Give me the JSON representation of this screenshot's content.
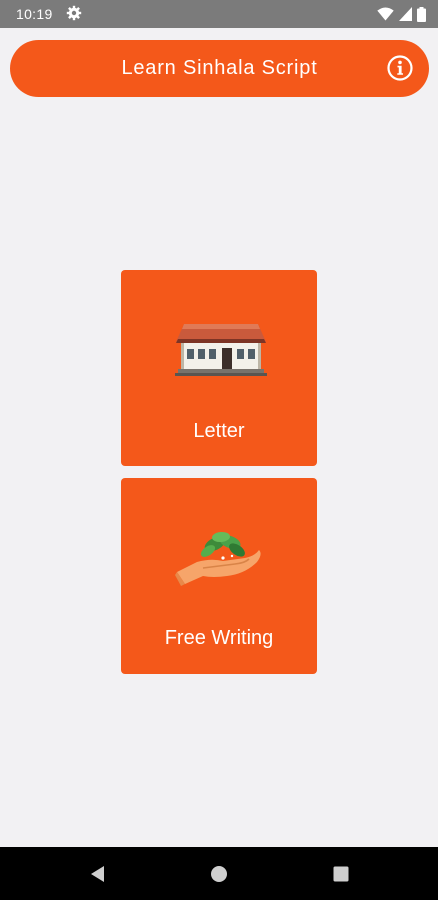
{
  "status_bar": {
    "time": "10:19",
    "icons": [
      "gear-icon",
      "wifi-icon",
      "signal-icon",
      "battery-icon"
    ]
  },
  "header": {
    "title": "Learn Sinhala Script",
    "info_icon": "info-icon"
  },
  "menu": {
    "items": [
      {
        "label": "Letter",
        "icon": "house-image"
      },
      {
        "label": "Free Writing",
        "icon": "hand-with-leaves-image"
      }
    ]
  },
  "nav_bar": {
    "buttons": [
      "back-icon",
      "home-icon",
      "recents-icon"
    ]
  },
  "colors": {
    "accent": "#f4581a",
    "background": "#f2f1f3",
    "status_bar": "#7b7b7b",
    "nav_bar": "#000000"
  }
}
